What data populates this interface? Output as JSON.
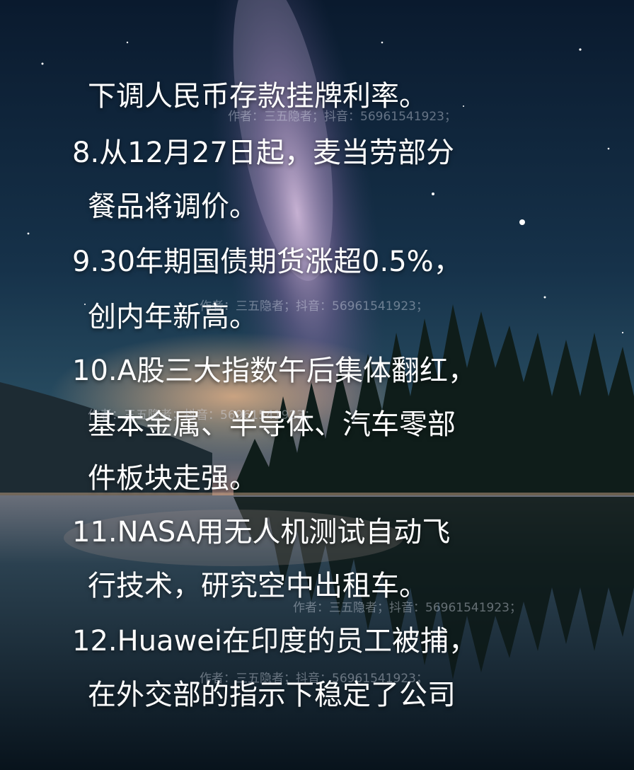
{
  "lines": [
    "下调人民币存款挂牌利率。",
    "8.从12月27日起，麦当劳部分",
    "餐品将调价。",
    "9.30年期国债期货涨超0.5%，",
    "创内年新高。",
    "10.A股三大指数午后集体翻红，",
    "基本金属、半导体、汽车零部",
    "件板块走强。",
    "11.NASA用无人机测试自动飞",
    "行技术，研究空中出租车。",
    "12.Huawei在印度的员工被捕，",
    "在外交部的指示下稳定了公司"
  ],
  "watermark": "作者：三五隐者；抖音：56961541923；"
}
